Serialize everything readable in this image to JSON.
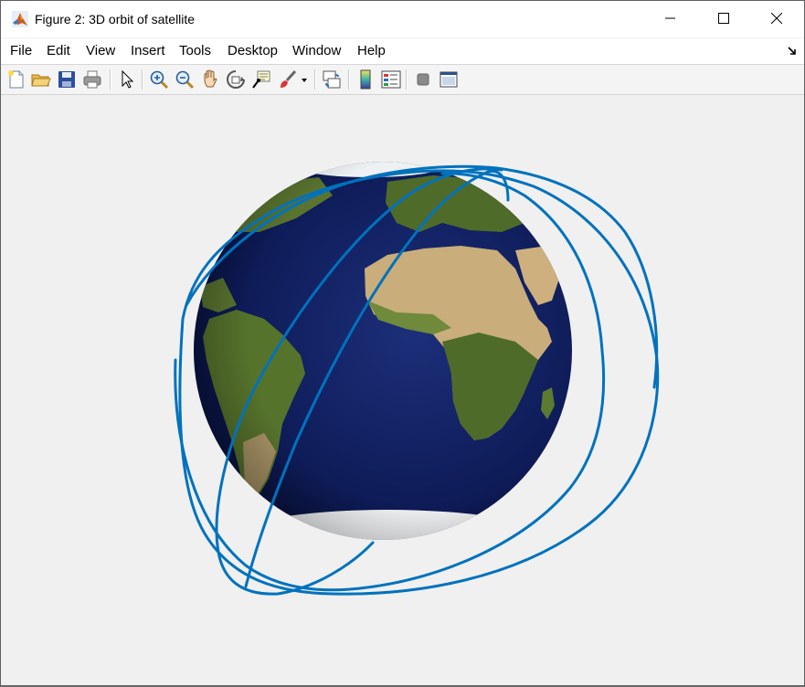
{
  "window": {
    "title": "Figure 2: 3D orbit of satellite",
    "controls": [
      "minimize",
      "maximize",
      "close"
    ]
  },
  "menu": [
    "File",
    "Edit",
    "View",
    "Insert",
    "Tools",
    "Desktop",
    "Window",
    "Help"
  ],
  "toolbar": [
    "new-figure-icon",
    "open-file-icon",
    "save-icon",
    "print-icon",
    "edit-plot-icon",
    "zoom-in-icon",
    "zoom-out-icon",
    "pan-icon",
    "rotate-3d-icon",
    "data-cursor-icon",
    "brush-icon",
    "brush-dropdown-icon",
    "link-plot-icon",
    "colorbar-icon",
    "legend-icon",
    "hide-plot-tools-icon",
    "show-plot-tools-icon"
  ],
  "colors": {
    "orbit": "#0072BD",
    "ocean": "#0d1a55",
    "land": "#5f7a2e",
    "desert": "#d8c08e",
    "figure_background": "#f0f0f0"
  }
}
